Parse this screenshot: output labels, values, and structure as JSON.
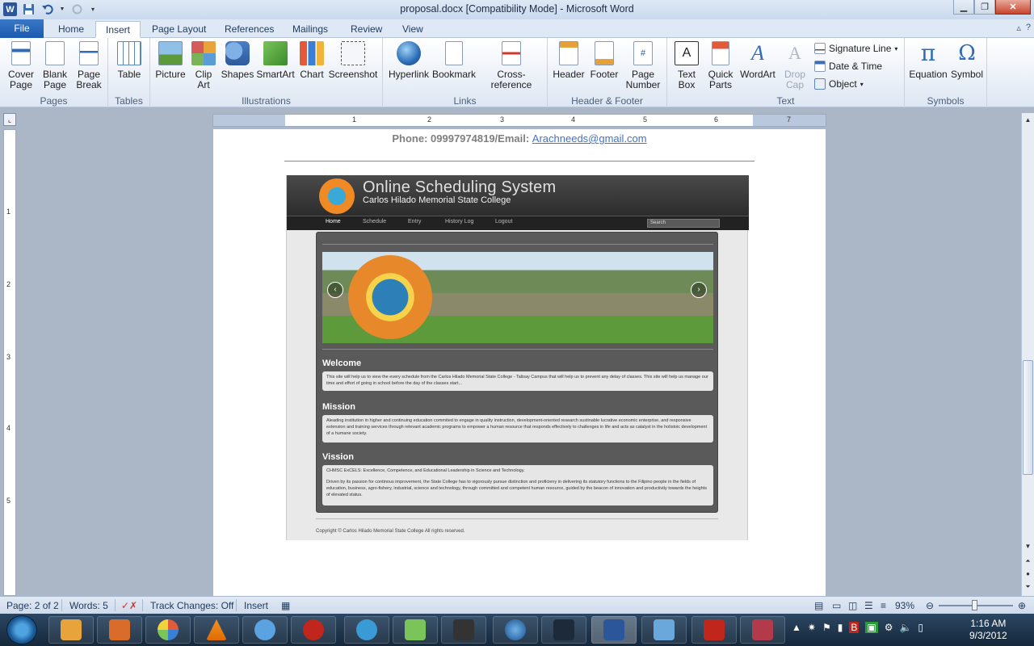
{
  "window": {
    "title": "proposal.docx [Compatibility Mode]  -  Microsoft Word",
    "quick_access": {
      "app_icon": "W"
    }
  },
  "tabs": {
    "items": [
      "File",
      "Home",
      "Insert",
      "Page Layout",
      "References",
      "Mailings",
      "Review",
      "View"
    ],
    "active": "Insert"
  },
  "ribbon": {
    "pages": {
      "label": "Pages",
      "cover": "Cover\nPage",
      "blank": "Blank\nPage",
      "break": "Page\nBreak"
    },
    "tables": {
      "label": "Tables",
      "table": "Table"
    },
    "illustrations": {
      "label": "Illustrations",
      "picture": "Picture",
      "clip": "Clip\nArt",
      "shapes": "Shapes",
      "smartart": "SmartArt",
      "chart": "Chart",
      "screenshot": "Screenshot"
    },
    "links": {
      "label": "Links",
      "hyperlink": "Hyperlink",
      "bookmark": "Bookmark",
      "crossref": "Cross-reference"
    },
    "headerfooter": {
      "label": "Header & Footer",
      "header": "Header",
      "footer": "Footer",
      "pagenum": "Page\nNumber"
    },
    "text": {
      "label": "Text",
      "textbox": "Text\nBox",
      "quickparts": "Quick\nParts",
      "wordart": "WordArt",
      "dropcap": "Drop\nCap",
      "sigline": "Signature Line",
      "datetime": "Date & Time",
      "object": "Object"
    },
    "symbols": {
      "label": "Symbols",
      "equation": "Equation",
      "symbol": "Symbol"
    }
  },
  "ruler": {
    "numbers": [
      "1",
      "2",
      "3",
      "4",
      "5",
      "6",
      "7"
    ],
    "vnumbers": [
      "1",
      "2",
      "3",
      "4",
      "5"
    ]
  },
  "document": {
    "contact_prefix": "Phone: 09997974819/Email: ",
    "contact_email": "Arachneeds@gmail.com",
    "screenshot": {
      "title": "Online Scheduling System",
      "subtitle": "Carlos Hilado Memorial State College",
      "nav": [
        "Home",
        "Schedule",
        "Entry",
        "History Log",
        "Logout"
      ],
      "search_placeholder": "Search",
      "welcome_title": "Welcome",
      "welcome_text": "This site will help us to view the every schedule from the Carlos Hilado Memorial State College - Talisay Campus that will help us to prevent any delay of classes. This site will help us manage our time and effort of going in school before the day of the classes start...",
      "mission_title": "Mission",
      "mission_text": "Aleading institution in higher and continuing education commited to engage in quality instruction, development-oriented research sustinable lucrative economic enterprise, and responsive extension and training services through relevant academic programs to empower a human resource that responds effectively to challenges in life and acts as catalyst in the holistoic development of a humane society.",
      "vission_title": "Vission",
      "vission_line1": "CHMSC ExCELS: Excellence, Competence, and Educational Leadership in Science and Technology.",
      "vission_line2": "Driven by its passion for continous improvement, the State College has to vigorously pursue distinction and proficieny in delivering its statutory functions to the Filipino people in the fields of education, business, agro-fishery, industrial, science and technology, through committed and competent human resource, guided by the beacon of innovation and productivity towards the heights of elevated status.",
      "copyright": "Copyright © Carlos Hilado Memorial State College All rights reserved."
    }
  },
  "status": {
    "page": "Page: 2 of 2",
    "words": "Words: 5",
    "track": "Track Changes: Off",
    "insert": "Insert",
    "zoom": "93%"
  },
  "taskbar": {
    "time": "1:16 AM",
    "date": "9/3/2012"
  },
  "colors": {
    "file_tab": "#1b5bb0",
    "link": "#4472c4"
  }
}
